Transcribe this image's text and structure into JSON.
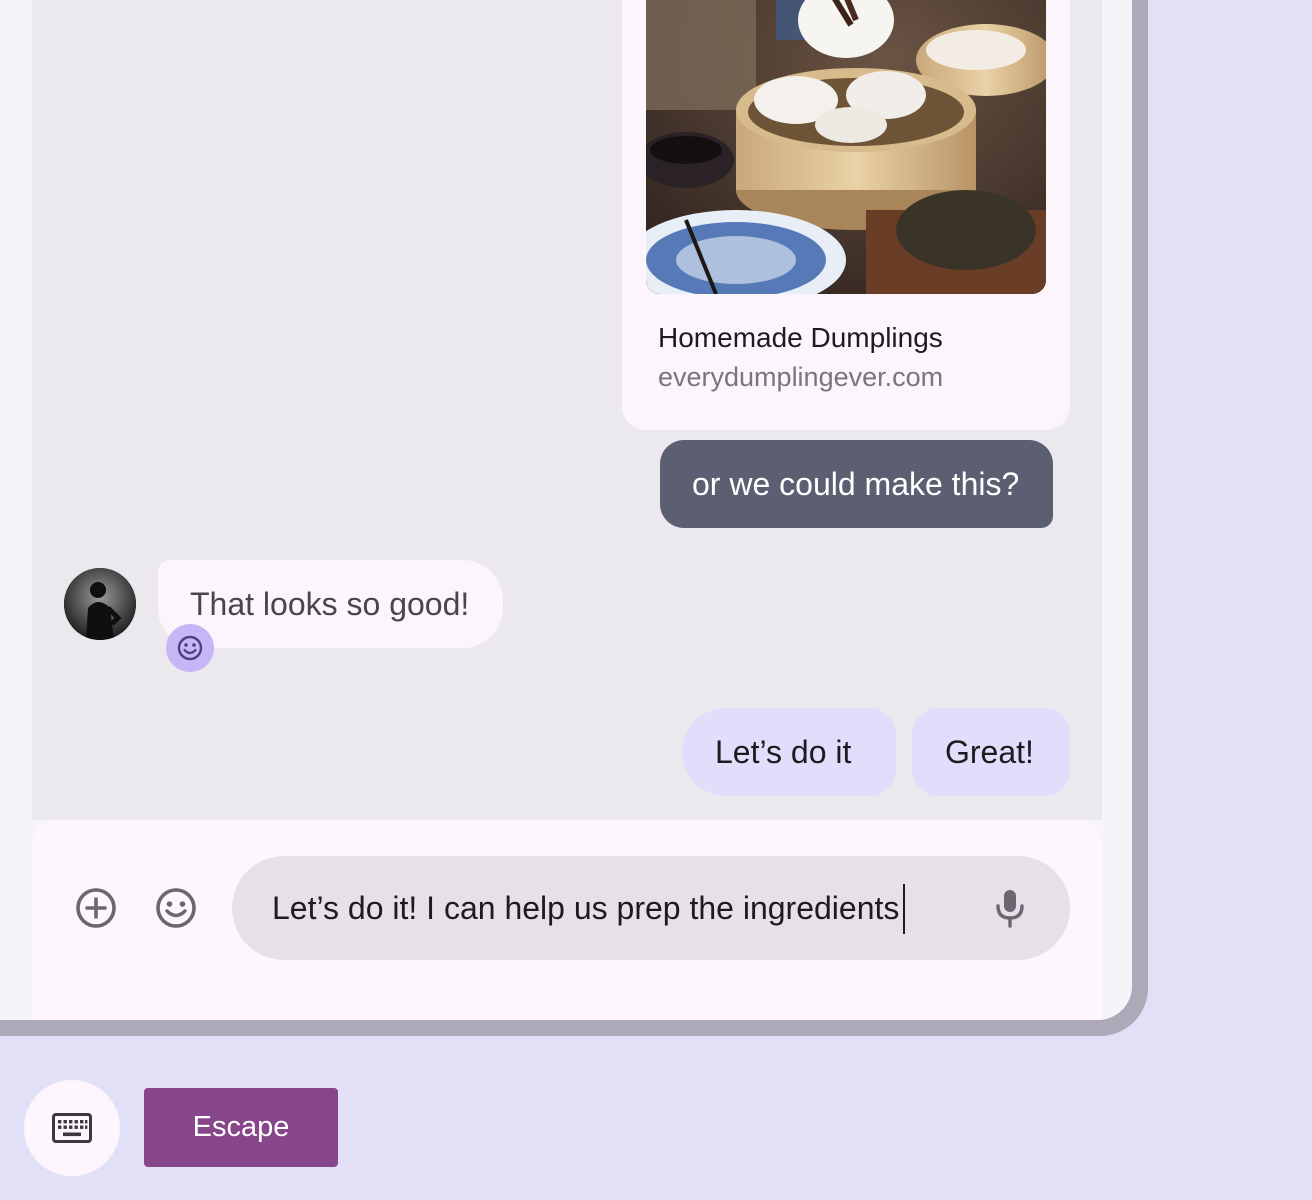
{
  "link_preview": {
    "title": "Homemade Dumplings",
    "url": "everydumplingever.com",
    "image": "dumplings-photo"
  },
  "messages": {
    "outgoing_1": "or we could make this?",
    "incoming_1": "That looks so good!",
    "reaction": "smiley-icon"
  },
  "suggestions": [
    "Let’s do it",
    "Great!"
  ],
  "composer": {
    "text": "Let’s do it! I can help us prep the ingredients",
    "add_icon": "add-circle-icon",
    "emoji_icon": "emoji-icon",
    "mic_icon": "mic-icon"
  },
  "bottom_bar": {
    "keyboard_icon": "keyboard-icon",
    "escape_label": "Escape"
  },
  "colors": {
    "background": "#e2e0f6",
    "chat_background": "#ece9ee",
    "outgoing_bubble": "#5c5e72",
    "suggestion_chip": "#e0defa",
    "reaction_badge": "#c5b6f6",
    "escape_button": "#87458a"
  }
}
